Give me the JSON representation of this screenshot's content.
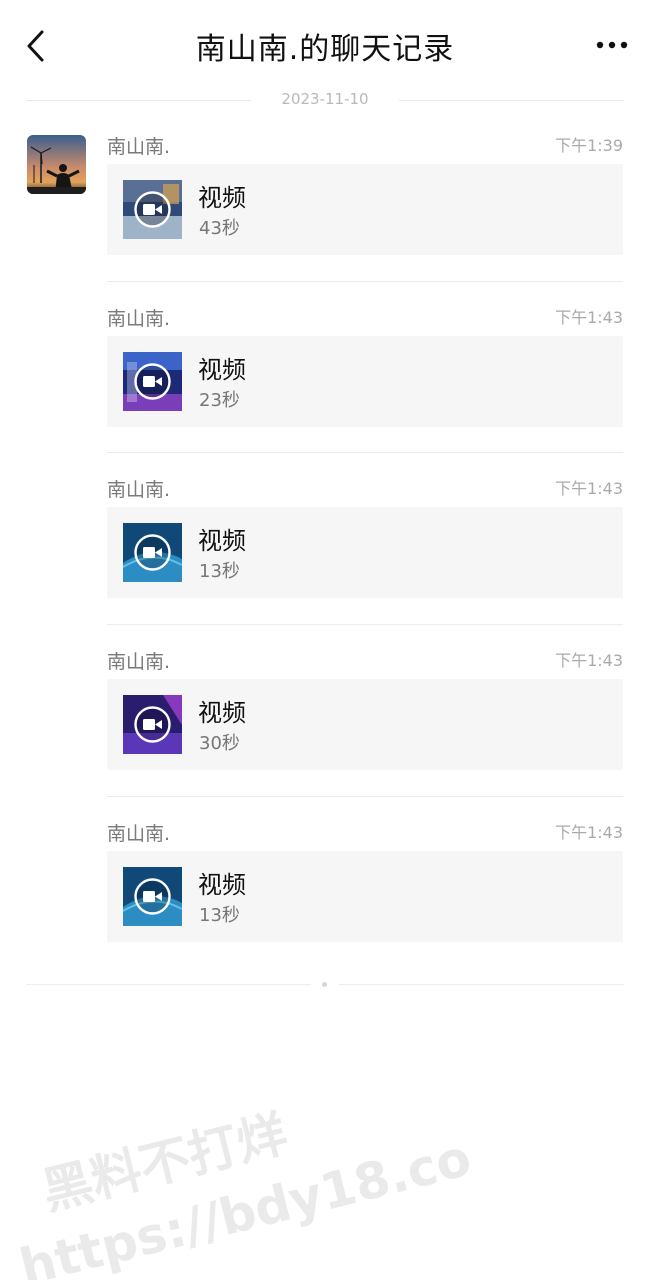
{
  "header": {
    "title": "南山南.的聊天记录",
    "back_icon": "chevron-left-icon",
    "more_icon": "more-dots-icon"
  },
  "date_divider": "2023-11-10",
  "messages": [
    {
      "sender": "南山南.",
      "time": "下午1:39",
      "label": "视频",
      "duration": "43秒",
      "thumb": "video-thumbnail",
      "thumb_colors": [
        "#2f4a78",
        "#9fb3c8",
        "#d8a24a"
      ]
    },
    {
      "sender": "南山南.",
      "time": "下午1:43",
      "label": "视频",
      "duration": "23秒",
      "thumb": "video-thumbnail",
      "thumb_colors": [
        "#1d2a78",
        "#3c63c8",
        "#7a3fb8"
      ]
    },
    {
      "sender": "南山南.",
      "time": "下午1:43",
      "label": "视频",
      "duration": "13秒",
      "thumb": "video-thumbnail",
      "thumb_colors": [
        "#104878",
        "#2c8cc4",
        "#62c0e6"
      ]
    },
    {
      "sender": "南山南.",
      "time": "下午1:43",
      "label": "视频",
      "duration": "30秒",
      "thumb": "video-thumbnail",
      "thumb_colors": [
        "#2a1d6e",
        "#5a36b8",
        "#a040d0"
      ]
    },
    {
      "sender": "南山南.",
      "time": "下午1:43",
      "label": "视频",
      "duration": "13秒",
      "thumb": "video-thumbnail",
      "thumb_colors": [
        "#104878",
        "#2c8cc4",
        "#62c0e6"
      ]
    }
  ],
  "watermark": {
    "line1": "黑料不打烊",
    "line2": "https://bdy18.co"
  },
  "colors": {
    "bubble_bg": "#f6f6f6",
    "secondary_text": "#7a7a7a",
    "time_text": "#aaaaaa"
  }
}
